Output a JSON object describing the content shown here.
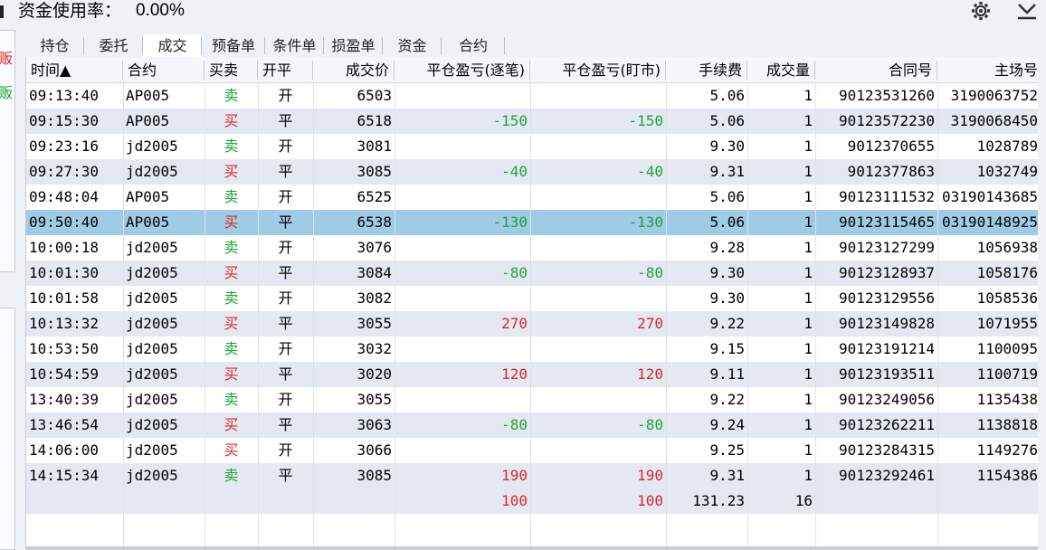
{
  "top": {
    "usage_label": "资金使用率：",
    "usage_value": "0.00%"
  },
  "tabs": [
    "持仓",
    "委托",
    "成交",
    "预备单",
    "条件单",
    "损盈单",
    "资金",
    "合约"
  ],
  "active_tab": 2,
  "columns": [
    "时间▲",
    "合约",
    "买卖",
    "开平",
    "成交价",
    "平仓盈亏(逐笔)",
    "平仓盈亏(盯市)",
    "手续费",
    "成交量",
    "合同号",
    "主场号"
  ],
  "rows": [
    [
      "09:13:40",
      "AP005",
      "卖",
      "开",
      "6503",
      "",
      "",
      "5.06",
      "1",
      "90123531260",
      "3190063752"
    ],
    [
      "09:15:30",
      "AP005",
      "买",
      "平",
      "6518",
      "-150",
      "-150",
      "5.06",
      "1",
      "90123572230",
      "3190068450"
    ],
    [
      "09:23:16",
      "jd2005",
      "卖",
      "开",
      "3081",
      "",
      "",
      "9.30",
      "1",
      "9012370655",
      "1028789"
    ],
    [
      "09:27:30",
      "jd2005",
      "买",
      "平",
      "3085",
      "-40",
      "-40",
      "9.31",
      "1",
      "9012377863",
      "1032749"
    ],
    [
      "09:48:04",
      "AP005",
      "卖",
      "开",
      "6525",
      "",
      "",
      "5.06",
      "1",
      "90123111532",
      "03190143685"
    ],
    [
      "09:50:40",
      "AP005",
      "买",
      "平",
      "6538",
      "-130",
      "-130",
      "5.06",
      "1",
      "90123115465",
      "03190148925"
    ],
    [
      "10:00:18",
      "jd2005",
      "卖",
      "开",
      "3076",
      "",
      "",
      "9.28",
      "1",
      "90123127299",
      "1056938"
    ],
    [
      "10:01:30",
      "jd2005",
      "买",
      "平",
      "3084",
      "-80",
      "-80",
      "9.30",
      "1",
      "90123128937",
      "1058176"
    ],
    [
      "10:01:58",
      "jd2005",
      "卖",
      "开",
      "3082",
      "",
      "",
      "9.30",
      "1",
      "90123129556",
      "1058536"
    ],
    [
      "10:13:32",
      "jd2005",
      "买",
      "平",
      "3055",
      "270",
      "270",
      "9.22",
      "1",
      "90123149828",
      "1071955"
    ],
    [
      "10:53:50",
      "jd2005",
      "卖",
      "开",
      "3032",
      "",
      "",
      "9.15",
      "1",
      "90123191214",
      "1100095"
    ],
    [
      "10:54:59",
      "jd2005",
      "买",
      "平",
      "3020",
      "120",
      "120",
      "9.11",
      "1",
      "90123193511",
      "1100719"
    ],
    [
      "13:40:39",
      "jd2005",
      "卖",
      "开",
      "3055",
      "",
      "",
      "9.22",
      "1",
      "90123249056",
      "1135438"
    ],
    [
      "13:46:54",
      "jd2005",
      "买",
      "平",
      "3063",
      "-80",
      "-80",
      "9.24",
      "1",
      "90123262211",
      "1138818"
    ],
    [
      "14:06:00",
      "jd2005",
      "买",
      "开",
      "3066",
      "",
      "",
      "9.25",
      "1",
      "90123284315",
      "1149276"
    ],
    [
      "14:15:34",
      "jd2005",
      "卖",
      "平",
      "3085",
      "190",
      "190",
      "9.31",
      "1",
      "90123292461",
      "1154386"
    ]
  ],
  "selected_row": 5,
  "totals": {
    "pnl_trade": "100",
    "pnl_mark": "100",
    "fee": "131.23",
    "volume": "16"
  },
  "side_labels": [
    "贩",
    "贩"
  ],
  "colors": {
    "buy": "#e0242a",
    "sell": "#1fa33b",
    "selected_row": "#9fcbe6",
    "alt_row": "#e4e9f1"
  },
  "icons": {
    "settings": "gear-icon",
    "collapse": "chevron-down-icon"
  }
}
